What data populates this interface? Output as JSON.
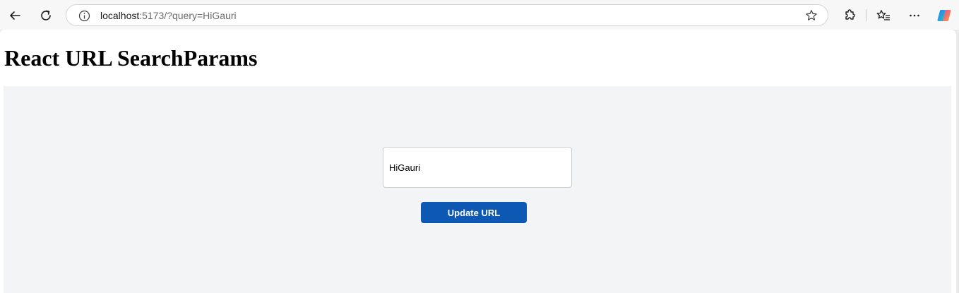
{
  "browser": {
    "url_host": "localhost",
    "url_rest": ":5173/?query=HiGauri",
    "icons": {
      "back": "back-arrow-icon",
      "reload": "reload-icon",
      "info": "info-icon",
      "favorite": "star-icon",
      "extensions": "extensions-icon",
      "favorites": "favorites-icon",
      "more": "more-icon",
      "copilot": "copilot-icon"
    }
  },
  "page": {
    "title": "React URL SearchParams",
    "search": {
      "value": "HiGauri"
    },
    "update_button_label": "Update URL"
  },
  "colors": {
    "primary_button": "#0c58b2",
    "panel_background": "#f3f4f6"
  }
}
